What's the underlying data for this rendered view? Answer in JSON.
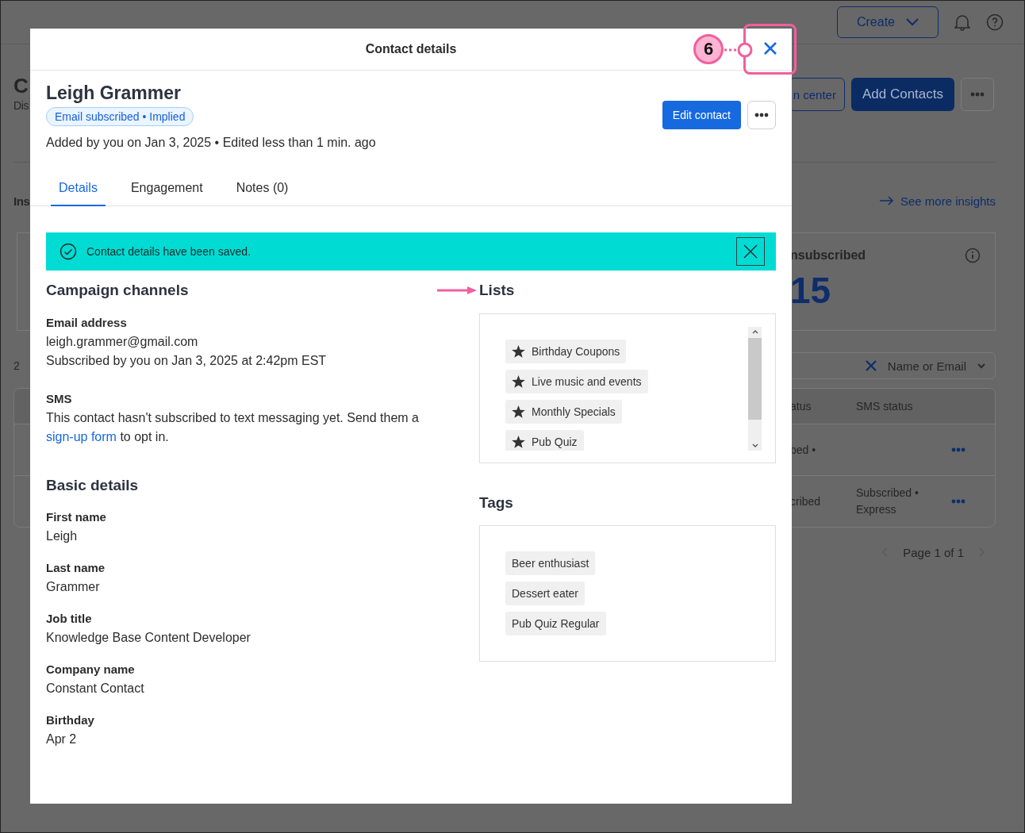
{
  "background": {
    "top_bar": {
      "create_button": "Create"
    },
    "page_header": {
      "title": "C",
      "subtitle": "Dis",
      "buttons": [
        {
          "label": "n center",
          "kind": "outline"
        },
        {
          "label": "Add Contacts",
          "kind": "primary"
        }
      ]
    },
    "insights": {
      "heading": "Ins",
      "link": "See more insights",
      "card": {
        "title": "nsubscribed",
        "value": "15"
      }
    },
    "contacts": {
      "count": "2",
      "search_filter": "Name or Email",
      "columns": [
        "atus",
        "SMS status"
      ],
      "rows": [
        {
          "column_1": "bed •"
        },
        {
          "column_1": "cribed",
          "column_2": "Subscribed • Express"
        }
      ],
      "pagination": "Page 1 of 1"
    }
  },
  "modal": {
    "title": "Contact details",
    "callout": {
      "number": "6"
    },
    "contact": {
      "name": "Leigh Grammer",
      "badge": "Email subscribed • Implied",
      "meta": "Added by you on Jan 3, 2025 • Edited less than 1 min. ago",
      "edit_button": "Edit contact"
    },
    "tabs": [
      {
        "label": "Details",
        "selected": true
      },
      {
        "label": "Engagement",
        "selected": false
      },
      {
        "label": "Notes (0)",
        "selected": false
      }
    ],
    "alert": {
      "message": "Contact details have been saved."
    },
    "campaign_channels": {
      "heading": "Campaign channels",
      "email": {
        "label": "Email address",
        "value": "leigh.grammer@gmail.com",
        "note": "Subscribed by you on Jan 3, 2025 at 2:42pm EST"
      },
      "sms": {
        "label": "SMS",
        "text_before": "This contact hasn't subscribed to text messaging yet. Send them a",
        "link": "sign-up form",
        "text_after": "to opt in."
      }
    },
    "basic_details": {
      "heading": "Basic details",
      "fields": [
        {
          "label": "First name",
          "value": "Leigh"
        },
        {
          "label": "Last name",
          "value": "Grammer"
        },
        {
          "label": "Job title",
          "value": "Knowledge Base Content Developer"
        },
        {
          "label": "Company name",
          "value": "Constant Contact"
        },
        {
          "label": "Birthday",
          "value": "Apr 2"
        }
      ]
    },
    "lists": {
      "heading": "Lists",
      "items": [
        "Birthday Coupons",
        "Live music and events",
        "Monthly Specials",
        "Pub Quiz"
      ]
    },
    "tags": {
      "heading": "Tags",
      "items": [
        "Beer enthusiast",
        "Dessert eater",
        "Pub Quiz Regular"
      ]
    }
  }
}
